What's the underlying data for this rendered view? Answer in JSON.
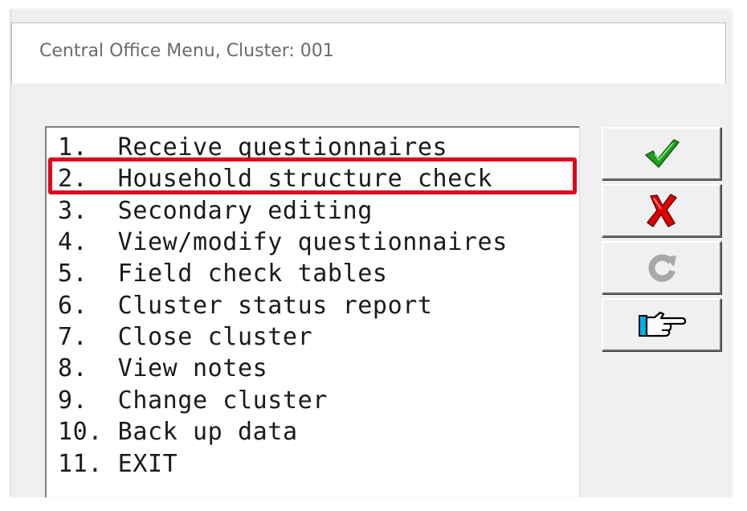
{
  "window": {
    "title": "Central Office Menu, Cluster: 001"
  },
  "menu": {
    "items": [
      {
        "number": "1.",
        "label": "Receive questionnaires"
      },
      {
        "number": "2.",
        "label": "Household structure check"
      },
      {
        "number": "3.",
        "label": "Secondary editing"
      },
      {
        "number": "4.",
        "label": "View/modify questionnaires"
      },
      {
        "number": "5.",
        "label": "Field check tables"
      },
      {
        "number": "6.",
        "label": "Cluster status report"
      },
      {
        "number": "7.",
        "label": "Close cluster"
      },
      {
        "number": "8.",
        "label": "View notes"
      },
      {
        "number": "9.",
        "label": "Change cluster"
      },
      {
        "number": "10.",
        "label": "Back up data"
      },
      {
        "number": "11.",
        "label": "EXIT"
      }
    ],
    "highlighted_item": 2
  },
  "buttons": [
    {
      "icon": "checkmark-icon",
      "color": "#1f9e1f"
    },
    {
      "icon": "red-x-icon",
      "color": "#e00000"
    },
    {
      "icon": "refresh-icon",
      "color": "#a8a8a8",
      "disabled": true
    },
    {
      "icon": "pointing-hand-icon",
      "color": "#000000"
    }
  ],
  "colors": {
    "highlight_border": "#e0001b",
    "list_text": "#1a1a1a",
    "title_text": "#6b6b6b"
  }
}
